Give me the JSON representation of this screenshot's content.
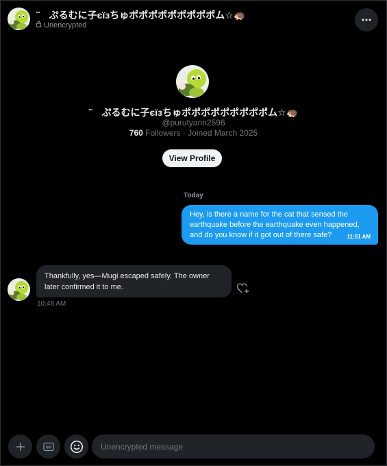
{
  "header": {
    "name": "˜　ぷるむに子єїзちゅポポポポポポポポポム☆🦔",
    "encryption_status": "Unencrypted",
    "more_icon": "more-horizontal-icon",
    "lock_icon": "lock-icon"
  },
  "profile": {
    "name": "˜　ぷるむに子єїзちゅポポポポポポポポポム☆🦔",
    "handle": "@purutyann2596",
    "followers_count": "760",
    "followers_label": "Followers",
    "joined": " · Joined March 2025",
    "view_profile_label": "View Profile"
  },
  "conversation": {
    "date_label": "Today",
    "messages": [
      {
        "direction": "outgoing",
        "text": "Hey, is there a name for the cat that sensed the earthquake before the earthquake even happened, and do you know if it got out of there safe?",
        "time": "11:51 AM"
      },
      {
        "direction": "incoming",
        "text": "Thankfully, yes—Mugi escaped safely. The owner later confirmed it to me.",
        "time": "10:48 AM"
      }
    ]
  },
  "composer": {
    "placeholder": "Unencrypted message",
    "add_icon": "plus-icon",
    "gif_icon": "gif-icon",
    "emoji_icon": "emoji-icon"
  },
  "colors": {
    "background": "#000000",
    "accent": "#1d9bf0",
    "incoming_bubble": "#202327",
    "muted_text": "#71767b"
  }
}
